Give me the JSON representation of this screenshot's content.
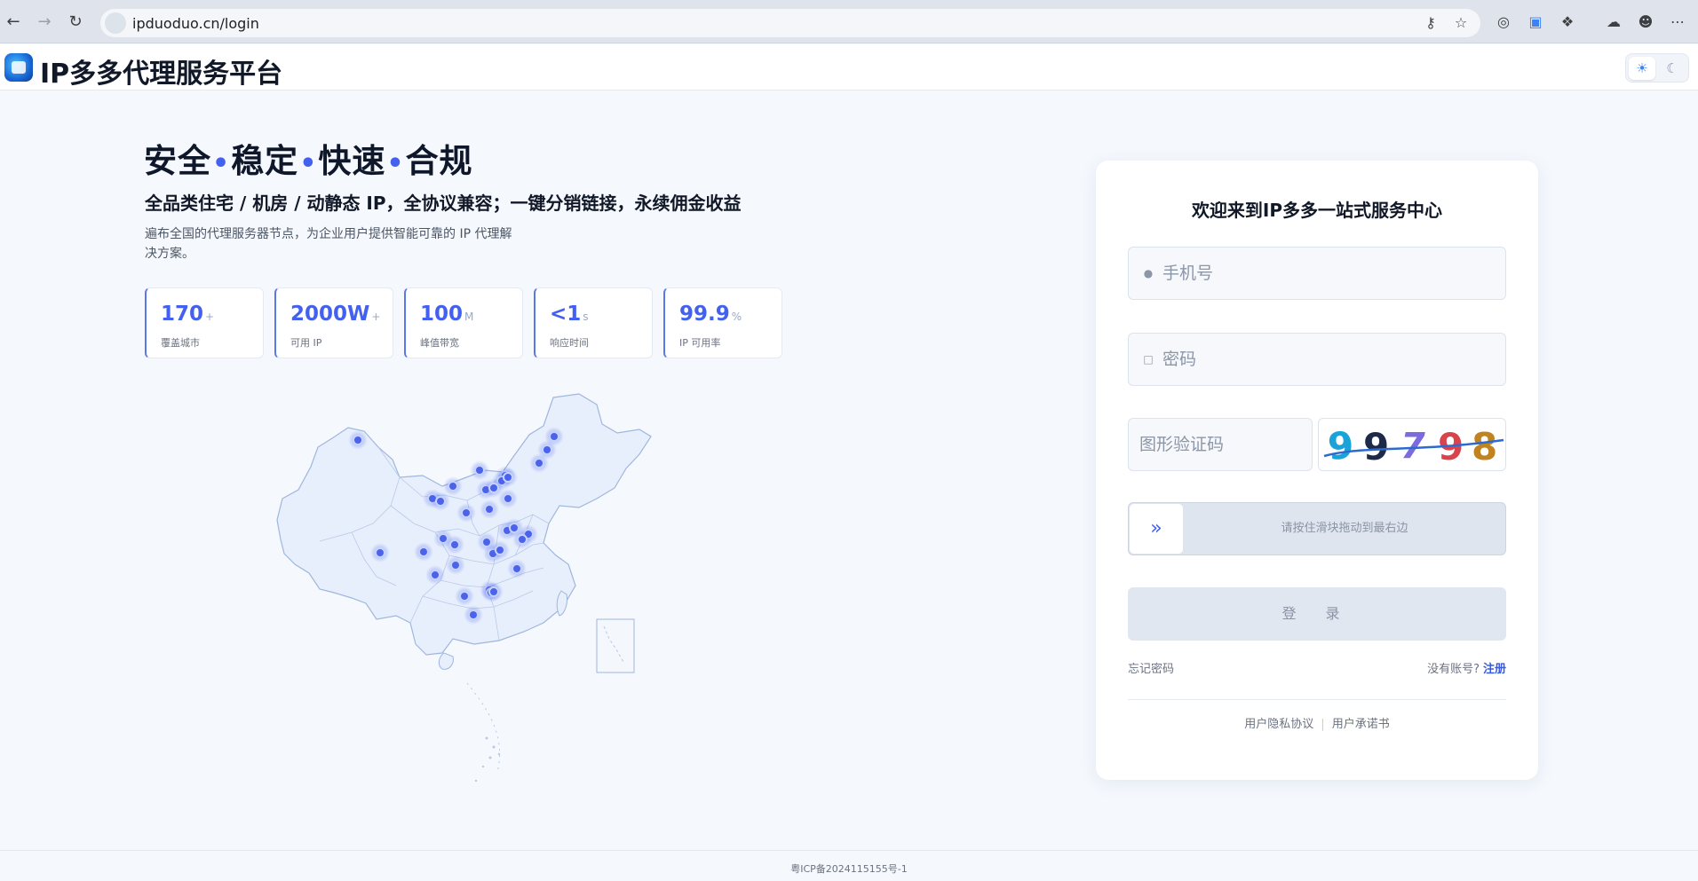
{
  "browser": {
    "url": "ipduoduo.cn/login",
    "back_icon": "arrow-left-icon",
    "forward_icon": "arrow-right-icon",
    "reload_icon": "reload-icon"
  },
  "header": {
    "title": "IP多多代理服务平台",
    "logo": "ipduoduo-logo",
    "theme_light_icon": "sun-icon",
    "theme_dark_icon": "moon-icon"
  },
  "hero": {
    "tagline": [
      "安全",
      "稳定",
      "快速",
      "合规"
    ],
    "tagline_separator": "•",
    "subtitle": "全品类住宅 / 机房 / 动静态 IP，全协议兼容；一键分销链接，永续佣金收益",
    "description": "遍布全国的代理服务器节点，为企业用户提供智能可靠的 IP 代理解决方案。"
  },
  "stats": [
    {
      "value": "170",
      "unit": "+",
      "label": "覆盖城市"
    },
    {
      "value": "2000W",
      "unit": "+",
      "label": "可用 IP"
    },
    {
      "value": "100",
      "unit": "M",
      "label": "峰值带宽"
    },
    {
      "value": "<1",
      "unit": "s",
      "label": "响应时间"
    },
    {
      "value": "99.9",
      "unit": "%",
      "label": "IP 可用率"
    }
  ],
  "login": {
    "title": "欢迎来到IP多多一站式服务中心",
    "phone_placeholder": "手机号",
    "password_placeholder": "密码",
    "captcha_placeholder": "图形验证码",
    "captcha_text": "99798",
    "slider_text": "请按住滑块拖动到最右边",
    "login_button": "登 录",
    "forgot_password": "忘记密码",
    "no_account": "没有账号?",
    "register": "注册",
    "privacy_policy": "用户隐私协议",
    "user_commitment": "用户承诺书"
  },
  "footer": {
    "icp": "粤ICP备2024115155号-1"
  },
  "colors": {
    "accent": "#4361ee",
    "background": "#f5f8fd",
    "card": "#ffffff"
  }
}
